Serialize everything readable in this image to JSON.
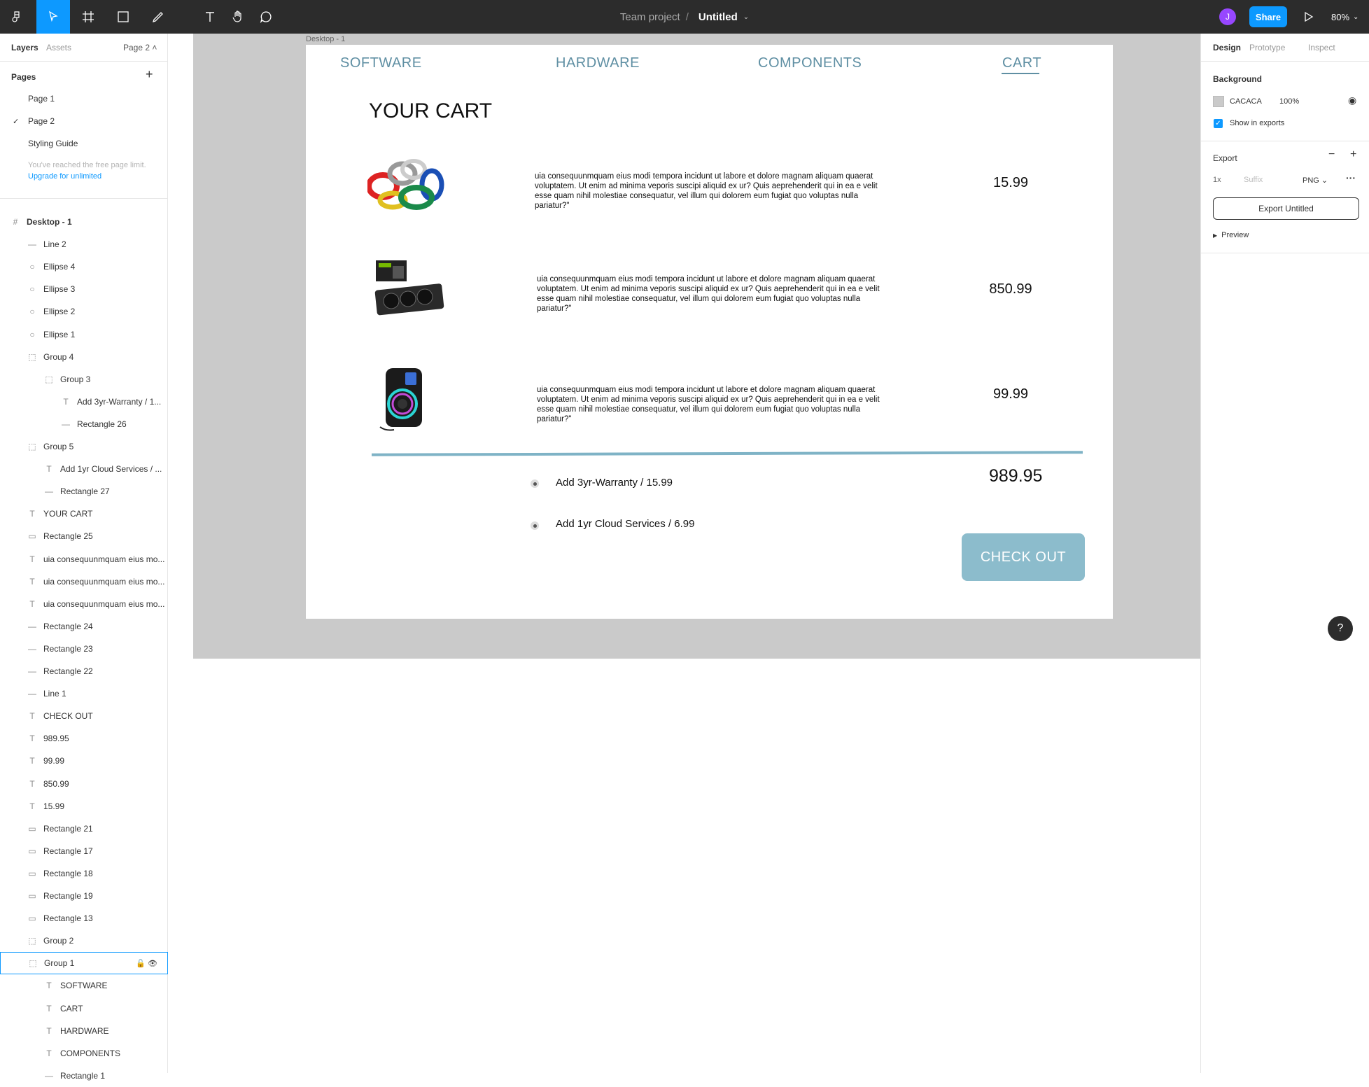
{
  "toolbar": {
    "project": "Team project",
    "separator": "/",
    "file_name": "Untitled",
    "avatar_initial": "J",
    "share_label": "Share",
    "zoom": "80%"
  },
  "left_panel": {
    "tabs": {
      "layers": "Layers",
      "assets": "Assets",
      "page": "Page 2"
    },
    "pages_title": "Pages",
    "pages": [
      "Page 1",
      "Page 2",
      "Styling Guide"
    ],
    "limit_note": "You've reached the free page limit.",
    "upgrade_link": "Upgrade for unlimited",
    "layers": [
      {
        "label": "Desktop - 1",
        "icon": "#"
      },
      {
        "label": "Line 2",
        "icon": "—"
      },
      {
        "label": "Ellipse 4",
        "icon": "○"
      },
      {
        "label": "Ellipse 3",
        "icon": "○"
      },
      {
        "label": "Ellipse 2",
        "icon": "○"
      },
      {
        "label": "Ellipse 1",
        "icon": "○"
      },
      {
        "label": "Group 4",
        "icon": "⬚"
      },
      {
        "label": "Group 3",
        "icon": "⬚"
      },
      {
        "label": "Add 3yr-Warranty / 1...",
        "icon": "T"
      },
      {
        "label": "Rectangle 26",
        "icon": "—"
      },
      {
        "label": "Group 5",
        "icon": "⬚"
      },
      {
        "label": "Add 1yr Cloud Services / ...",
        "icon": "T"
      },
      {
        "label": "Rectangle 27",
        "icon": "—"
      },
      {
        "label": "YOUR CART",
        "icon": "T"
      },
      {
        "label": "Rectangle 25",
        "icon": "▭"
      },
      {
        "label": "uia consequunmquam eius mo...",
        "icon": "T"
      },
      {
        "label": "uia consequunmquam eius mo...",
        "icon": "T"
      },
      {
        "label": "uia consequunmquam eius mo...",
        "icon": "T"
      },
      {
        "label": "Rectangle 24",
        "icon": "—"
      },
      {
        "label": "Rectangle 23",
        "icon": "—"
      },
      {
        "label": "Rectangle 22",
        "icon": "—"
      },
      {
        "label": "Line 1",
        "icon": "—"
      },
      {
        "label": "CHECK OUT",
        "icon": "T"
      },
      {
        "label": "989.95",
        "icon": "T"
      },
      {
        "label": "99.99",
        "icon": "T"
      },
      {
        "label": "850.99",
        "icon": "T"
      },
      {
        "label": "15.99",
        "icon": "T"
      },
      {
        "label": "Rectangle 21",
        "icon": "▭"
      },
      {
        "label": "Rectangle 17",
        "icon": "▭"
      },
      {
        "label": "Rectangle 18",
        "icon": "▭"
      },
      {
        "label": "Rectangle 19",
        "icon": "▭"
      },
      {
        "label": "Rectangle 13",
        "icon": "▭"
      },
      {
        "label": "Group 2",
        "icon": "⬚"
      },
      {
        "label": "Group 1",
        "icon": "⬚"
      },
      {
        "label": "SOFTWARE",
        "icon": "T"
      },
      {
        "label": "CART",
        "icon": "T"
      },
      {
        "label": "HARDWARE",
        "icon": "T"
      },
      {
        "label": "COMPONENTS",
        "icon": "T"
      },
      {
        "label": "Rectangle 1",
        "icon": "—"
      }
    ]
  },
  "canvas": {
    "frame_label": "Desktop - 1",
    "nav": {
      "software": "SOFTWARE",
      "hardware": "HARDWARE",
      "components": "COMPONENTS",
      "cart": "CART"
    },
    "title": "YOUR CART",
    "description": "uia consequunmquam eius modi tempora incidunt ut labore et dolore magnam aliquam quaerat voluptatem. Ut enim ad minima veporis suscipi aliquid ex ur? Quis aeprehenderit qui in ea e velit esse quam nihil molestiae consequatur, vel illum qui dolorem eum fugiat quo voluptas nulla pariatur?\"",
    "prices": [
      "15.99",
      "850.99",
      "99.99"
    ],
    "addons": [
      "Add 3yr-Warranty / 15.99",
      "Add 1yr Cloud Services / 6.99"
    ],
    "total": "989.95",
    "checkout": "CHECK OUT"
  },
  "right_panel": {
    "tabs": {
      "design": "Design",
      "prototype": "Prototype",
      "inspect": "Inspect"
    },
    "background_title": "Background",
    "bg_hex": "CACACA",
    "bg_opacity": "100%",
    "show_in_exports": "Show in exports",
    "export_title": "Export",
    "export_scale": "1x",
    "export_suffix_placeholder": "Suffix",
    "export_format": "PNG",
    "export_button": "Export Untitled",
    "preview": "Preview"
  },
  "help": "?"
}
